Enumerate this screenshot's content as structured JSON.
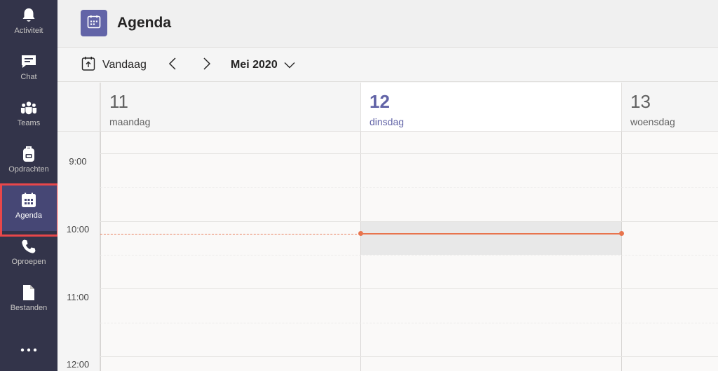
{
  "sidebar": {
    "items": [
      {
        "label": "Activiteit",
        "icon": "bell-icon"
      },
      {
        "label": "Chat",
        "icon": "chat-icon"
      },
      {
        "label": "Teams",
        "icon": "teams-icon"
      },
      {
        "label": "Opdrachten",
        "icon": "backpack-icon"
      },
      {
        "label": "Agenda",
        "icon": "calendar-icon",
        "active": true
      },
      {
        "label": "Oproepen",
        "icon": "phone-icon"
      },
      {
        "label": "Bestanden",
        "icon": "file-icon"
      }
    ],
    "more_icon": "more-dots-icon"
  },
  "header": {
    "title": "Agenda",
    "app_icon": "calendar-icon"
  },
  "toolbar": {
    "today_label": "Vandaag",
    "today_icon": "calendar-today-icon",
    "prev_icon": "chevron-left-icon",
    "next_icon": "chevron-right-icon",
    "month_label": "Mei 2020",
    "month_icon": "chevron-down-icon"
  },
  "calendar": {
    "days": [
      {
        "number": "11",
        "name": "maandag",
        "today": false
      },
      {
        "number": "12",
        "name": "dinsdag",
        "today": true
      },
      {
        "number": "13",
        "name": "woensdag",
        "today": false
      }
    ],
    "times": [
      "9:00",
      "10:00",
      "11:00",
      "12:00"
    ],
    "current_time_line_time": "10:18"
  },
  "colors": {
    "sidebar_bg": "#33344a",
    "sidebar_active": "#464775",
    "accent": "#6264a7",
    "now_line": "#e8744d",
    "highlight_border": "#e8474a"
  }
}
